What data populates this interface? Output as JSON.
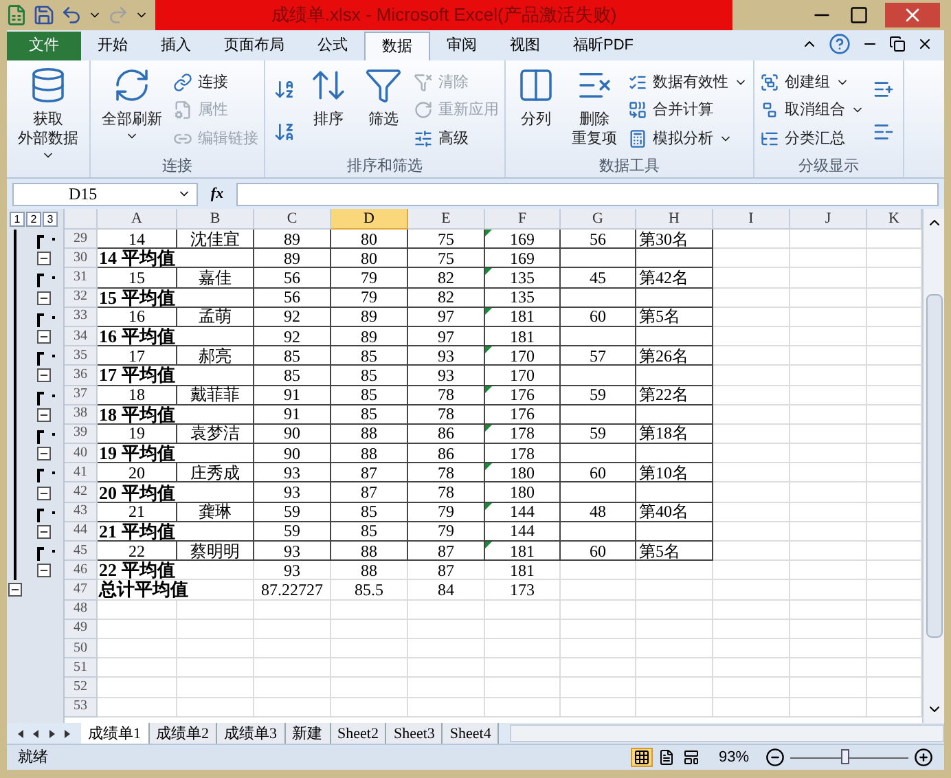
{
  "window": {
    "title": "成绩单.xlsx - Microsoft Excel(产品激活失败)"
  },
  "menu_tabs": [
    {
      "label": "文件",
      "kind": "file",
      "selected": false
    },
    {
      "label": "开始",
      "kind": "tab",
      "selected": false
    },
    {
      "label": "插入",
      "kind": "tab",
      "selected": false
    },
    {
      "label": "页面布局",
      "kind": "tab",
      "selected": false
    },
    {
      "label": "公式",
      "kind": "tab",
      "selected": false
    },
    {
      "label": "数据",
      "kind": "tab",
      "selected": true
    },
    {
      "label": "审阅",
      "kind": "tab",
      "selected": false
    },
    {
      "label": "视图",
      "kind": "tab",
      "selected": false
    },
    {
      "label": "福昕PDF",
      "kind": "tab",
      "selected": false
    }
  ],
  "ribbon_groups": [
    {
      "items": [
        {
          "kind": "large",
          "lines": [
            "获取",
            "外部数据"
          ],
          "dropdown": true,
          "disabled": false
        }
      ]
    },
    {
      "label": "连接",
      "items": [
        {
          "kind": "large",
          "lines": [
            "全部刷新"
          ],
          "dropdown": true,
          "disabled": false
        },
        {
          "kind": "small",
          "label": "连接",
          "disabled": false
        },
        {
          "kind": "small",
          "label": "属性",
          "disabled": true
        },
        {
          "kind": "small",
          "label": "编辑链接",
          "disabled": true
        }
      ]
    },
    {
      "label": "排序和筛选",
      "items": [
        {
          "kind": "icon",
          "disabled": false
        },
        {
          "kind": "icon",
          "disabled": false
        },
        {
          "kind": "large",
          "lines": [
            "排序"
          ],
          "dropdown": false,
          "disabled": false
        },
        {
          "kind": "large",
          "lines": [
            "筛选"
          ],
          "dropdown": false,
          "disabled": false
        },
        {
          "kind": "small",
          "label": "清除",
          "disabled": true
        },
        {
          "kind": "small",
          "label": "重新应用",
          "disabled": true
        },
        {
          "kind": "small",
          "label": "高级",
          "disabled": false
        }
      ]
    },
    {
      "label": "数据工具",
      "items": [
        {
          "kind": "large",
          "lines": [
            "分列"
          ],
          "dropdown": false,
          "disabled": false
        },
        {
          "kind": "large",
          "lines": [
            "删除",
            "重复项"
          ],
          "dropdown": false,
          "disabled": false
        },
        {
          "kind": "small",
          "label": "数据有效性",
          "dropdown": true,
          "disabled": false
        },
        {
          "kind": "small",
          "label": "合并计算",
          "disabled": false
        },
        {
          "kind": "small",
          "label": "模拟分析",
          "dropdown": true,
          "disabled": false
        }
      ]
    },
    {
      "label": "分级显示",
      "items": [
        {
          "kind": "small",
          "label": "创建组",
          "dropdown": true,
          "disabled": false
        },
        {
          "kind": "small",
          "label": "取消组合",
          "dropdown": true,
          "disabled": false
        },
        {
          "kind": "small",
          "label": "分类汇总",
          "disabled": false
        },
        {
          "kind": "icon",
          "disabled": false
        },
        {
          "kind": "icon",
          "disabled": false
        }
      ]
    }
  ],
  "formula_bar": {
    "name_box": "D15",
    "fx": "fx"
  },
  "outline_levels": [
    "1",
    "2",
    "3"
  ],
  "columns": [
    {
      "label": "A",
      "selected": false
    },
    {
      "label": "B",
      "selected": false
    },
    {
      "label": "C",
      "selected": false
    },
    {
      "label": "D",
      "selected": true
    },
    {
      "label": "E",
      "selected": false
    },
    {
      "label": "F",
      "selected": false
    },
    {
      "label": "G",
      "selected": false
    },
    {
      "label": "H",
      "selected": false
    },
    {
      "label": "I",
      "selected": false
    },
    {
      "label": "J",
      "selected": false
    },
    {
      "label": "K",
      "selected": false
    }
  ],
  "rows": [
    {
      "number": "29",
      "kind": "data",
      "error_flag": true,
      "cells": [
        "14",
        "沈佳宜",
        "89",
        "80",
        "75",
        "169",
        "56",
        "第30名"
      ]
    },
    {
      "number": "30",
      "kind": "subtotal",
      "cells": [
        "14 平均值",
        "",
        "89",
        "80",
        "75",
        "169",
        "",
        ""
      ]
    },
    {
      "number": "31",
      "kind": "data",
      "error_flag": true,
      "cells": [
        "15",
        "嘉佳",
        "56",
        "79",
        "82",
        "135",
        "45",
        "第42名"
      ]
    },
    {
      "number": "32",
      "kind": "subtotal",
      "cells": [
        "15 平均值",
        "",
        "56",
        "79",
        "82",
        "135",
        "",
        ""
      ]
    },
    {
      "number": "33",
      "kind": "data",
      "error_flag": true,
      "cells": [
        "16",
        "孟萌",
        "92",
        "89",
        "97",
        "181",
        "60",
        "第5名"
      ]
    },
    {
      "number": "34",
      "kind": "subtotal",
      "cells": [
        "16 平均值",
        "",
        "92",
        "89",
        "97",
        "181",
        "",
        ""
      ]
    },
    {
      "number": "35",
      "kind": "data",
      "error_flag": true,
      "cells": [
        "17",
        "郝亮",
        "85",
        "85",
        "93",
        "170",
        "57",
        "第26名"
      ]
    },
    {
      "number": "36",
      "kind": "subtotal",
      "cells": [
        "17 平均值",
        "",
        "85",
        "85",
        "93",
        "170",
        "",
        ""
      ]
    },
    {
      "number": "37",
      "kind": "data",
      "error_flag": true,
      "cells": [
        "18",
        "戴菲菲",
        "91",
        "85",
        "78",
        "176",
        "59",
        "第22名"
      ]
    },
    {
      "number": "38",
      "kind": "subtotal",
      "cells": [
        "18 平均值",
        "",
        "91",
        "85",
        "78",
        "176",
        "",
        ""
      ]
    },
    {
      "number": "39",
      "kind": "data",
      "error_flag": true,
      "cells": [
        "19",
        "袁梦洁",
        "90",
        "88",
        "86",
        "178",
        "59",
        "第18名"
      ]
    },
    {
      "number": "40",
      "kind": "subtotal",
      "cells": [
        "19 平均值",
        "",
        "90",
        "88",
        "86",
        "178",
        "",
        ""
      ]
    },
    {
      "number": "41",
      "kind": "data",
      "error_flag": true,
      "cells": [
        "20",
        "庄秀成",
        "93",
        "87",
        "78",
        "180",
        "60",
        "第10名"
      ]
    },
    {
      "number": "42",
      "kind": "subtotal",
      "cells": [
        "20 平均值",
        "",
        "93",
        "87",
        "78",
        "180",
        "",
        ""
      ]
    },
    {
      "number": "43",
      "kind": "data",
      "error_flag": true,
      "cells": [
        "21",
        "龚琳",
        "59",
        "85",
        "79",
        "144",
        "48",
        "第40名"
      ]
    },
    {
      "number": "44",
      "kind": "subtotal",
      "cells": [
        "21 平均值",
        "",
        "59",
        "85",
        "79",
        "144",
        "",
        ""
      ]
    },
    {
      "number": "45",
      "kind": "data",
      "error_flag": true,
      "cells": [
        "22",
        "蔡明明",
        "93",
        "88",
        "87",
        "181",
        "60",
        "第5名"
      ]
    },
    {
      "number": "46",
      "kind": "subtotal_last",
      "cells": [
        "22 平均值",
        "",
        "93",
        "88",
        "87",
        "181",
        "",
        ""
      ]
    },
    {
      "number": "47",
      "kind": "total",
      "cells": [
        "总计平均值",
        "",
        "87.22727",
        "85.5",
        "84",
        "173",
        "",
        ""
      ]
    },
    {
      "number": "48",
      "kind": "empty"
    },
    {
      "number": "49",
      "kind": "empty"
    },
    {
      "number": "50",
      "kind": "empty"
    },
    {
      "number": "51",
      "kind": "empty"
    },
    {
      "number": "52",
      "kind": "empty"
    },
    {
      "number": "53",
      "kind": "empty"
    }
  ],
  "sheet_tabs": [
    {
      "label": "成绩单1",
      "selected": true
    },
    {
      "label": "成绩单2",
      "selected": false
    },
    {
      "label": "成绩单3",
      "selected": false
    },
    {
      "label": "新建",
      "selected": false
    },
    {
      "label": "Sheet2",
      "selected": false
    },
    {
      "label": "Sheet3",
      "selected": false
    },
    {
      "label": "Sheet4",
      "selected": false
    }
  ],
  "status_bar": {
    "status": "就绪",
    "views": [
      {
        "selected": true
      },
      {
        "selected": false
      },
      {
        "selected": false
      }
    ],
    "zoom": "93%",
    "zoom_slider": {
      "level": 0.47
    }
  }
}
